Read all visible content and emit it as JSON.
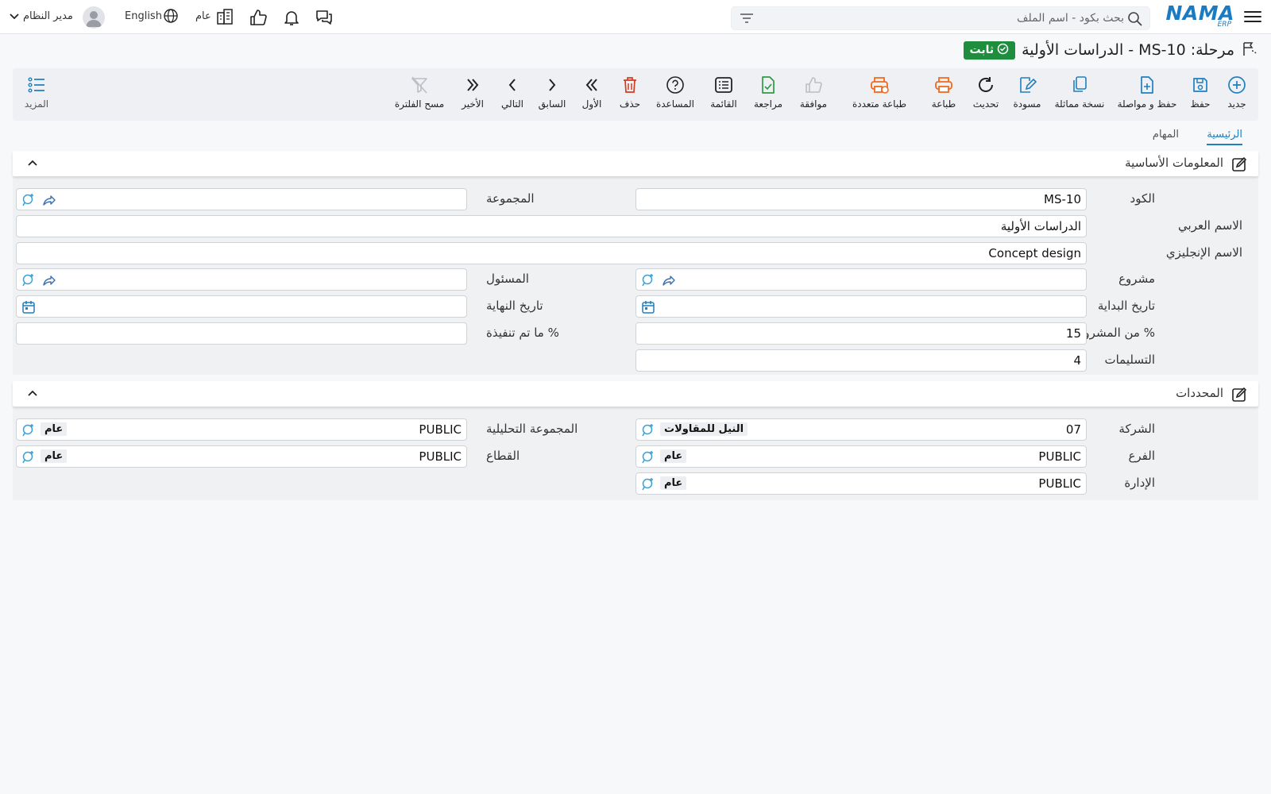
{
  "topbar": {
    "logo_text": "NAMA",
    "logo_sub": "ERP",
    "search_placeholder": "بحث بكود - اسم الملف",
    "company_label": "عام",
    "language_label": "English",
    "user_name": "مدير النظام"
  },
  "header": {
    "title": "مرحلة: MS-10 - الدراسات الأولية",
    "status_badge": "ثابت",
    "status_color": "#1e8e3e"
  },
  "toolbar": {
    "new": "جديد",
    "save": "حفظ",
    "save_continue": "حفظ و مواصلة",
    "duplicate": "نسخة مماثلة",
    "draft": "مسودة",
    "refresh": "تحديث",
    "print": "طباعة",
    "multi_print": "طباعة متعددة",
    "approve": "موافقة",
    "review": "مراجعة",
    "list": "القائمة",
    "help": "المساعدة",
    "delete": "حذف",
    "first": "الأول",
    "previous": "السابق",
    "next": "التالي",
    "last": "الأخير",
    "clear_filter": "مسح الفلترة",
    "more": "المزيد"
  },
  "tabs": [
    {
      "label": "الرئيسية",
      "active": true
    },
    {
      "label": "المهام",
      "active": false
    }
  ],
  "basic_info": {
    "title": "المعلومات الأساسية",
    "code_label": "الكود",
    "code_value": "MS-10",
    "group_label": "المجموعة",
    "group_value": "",
    "arabic_name_label": "الاسم العربي",
    "arabic_name_value": "الدراسات الأولية",
    "english_name_label": "الاسم الإنجليزي",
    "english_name_value": "Concept design",
    "project_label": "مشروع",
    "project_value": "",
    "responsible_label": "المسئول",
    "responsible_value": "",
    "start_date_label": "تاريخ البداية",
    "start_date_value": "",
    "end_date_label": "تاريخ النهاية",
    "end_date_value": "",
    "project_percent_label": "% من المشروع",
    "project_percent_value": "15",
    "done_percent_label": "% ما تم تنفيذة",
    "done_percent_value": "",
    "deliverables_label": "التسليمات",
    "deliverables_value": "4"
  },
  "dimensions": {
    "title": "المحددات",
    "company_label": "الشركة",
    "company_code": "07",
    "company_name": "النيل للمقاولات",
    "analysis_group_label": "المجموعة التحليلية",
    "analysis_group_code": "PUBLIC",
    "analysis_group_name": "عام",
    "branch_label": "الفرع",
    "branch_code": "PUBLIC",
    "branch_name": "عام",
    "sector_label": "القطاع",
    "sector_code": "PUBLIC",
    "sector_name": "عام",
    "department_label": "الإدارة",
    "department_code": "PUBLIC",
    "department_name": "عام"
  }
}
